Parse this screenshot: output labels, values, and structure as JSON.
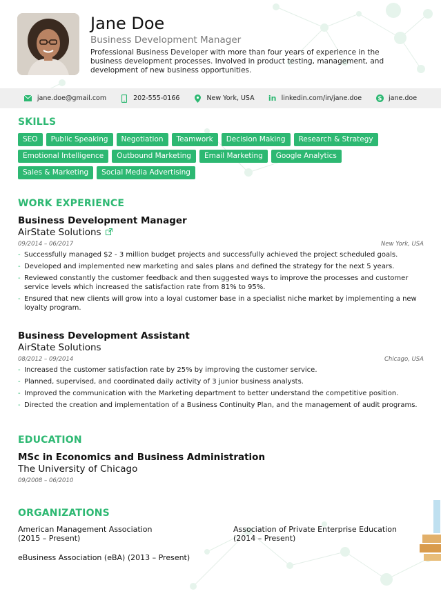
{
  "person": {
    "name": "Jane Doe",
    "title": "Business Development Manager",
    "summary": "Professional Business Developer with more than four years of experience in the business development processes. Involved in product testing, management, and development of new business opportunities."
  },
  "contact": {
    "email": "jane.doe@gmail.com",
    "phone": "202-555-0166",
    "location": "New York, USA",
    "linkedin": "linkedin.com/in/jane.doe",
    "skype": "jane.doe"
  },
  "sections": {
    "skills": "SKILLS",
    "work": "WORK EXPERIENCE",
    "education": "EDUCATION",
    "organizations": "ORGANIZATIONS"
  },
  "skills": [
    "SEO",
    "Public Speaking",
    "Negotiation",
    "Teamwork",
    "Decision Making",
    "Research & Strategy",
    "Emotional Intelligence",
    "Outbound Marketing",
    "Email Marketing",
    "Google Analytics",
    "Sales & Marketing",
    "Social Media Advertising"
  ],
  "jobs": [
    {
      "role": "Business Development Manager",
      "company": "AirState Solutions",
      "dates": "09/2014 – 06/2017",
      "location": "New York, USA",
      "bullets": [
        "Successfully managed $2 - 3 million budget projects and successfully achieved the project scheduled goals.",
        "Developed and implemented new marketing and sales plans and defined the strategy for the next 5 years.",
        "Reviewed constantly the customer feedback and then suggested ways to improve the processes and customer service levels which increased the satisfaction rate from 81% to 95%.",
        "Ensured that new clients will grow into a loyal customer base in a specialist niche market by implementing a new loyalty program."
      ]
    },
    {
      "role": "Business Development Assistant",
      "company": "AirState Solutions",
      "dates": "08/2012 – 09/2014",
      "location": "Chicago, USA",
      "bullets": [
        "Increased the customer satisfaction rate by 25% by improving the customer service.",
        "Planned, supervised, and coordinated daily activity of 3 junior business analysts.",
        "Improved the communication with the Marketing department to better understand the competitive position.",
        "Directed the creation and implementation of a Business Continuity Plan, and the management of audit programs."
      ]
    }
  ],
  "education": {
    "degree": "MSc in Economics and Business Administration",
    "school": "The University of Chicago",
    "dates": "09/2008 – 06/2010"
  },
  "organizations": [
    {
      "name": "American Management Association",
      "period": "(2015 – Present)"
    },
    {
      "name": "Association of Private Enterprise Education",
      "period": "(2014 – Present)"
    },
    {
      "name": "eBusiness Association (eBA) (2013 – Present)",
      "period": ""
    }
  ],
  "accent_color": "#2db872"
}
